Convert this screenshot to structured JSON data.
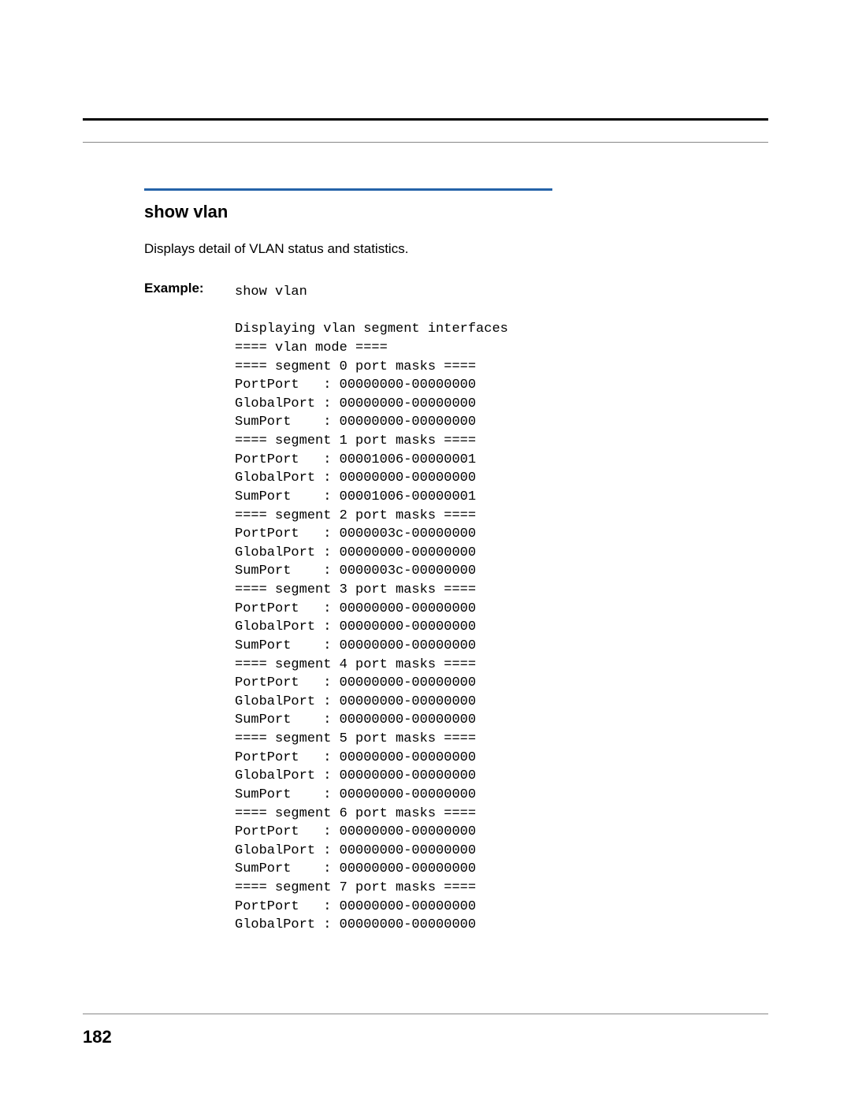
{
  "section": {
    "title": "show vlan",
    "description": "Displays detail of VLAN status and statistics.",
    "example_label": "Example:"
  },
  "code": {
    "cmd": "show vlan",
    "blank1": "",
    "l1": "Displaying vlan segment interfaces",
    "l2": "==== vlan mode ====",
    "l3": "==== segment 0 port masks ====",
    "l4": "PortPort   : 00000000-00000000",
    "l5": "GlobalPort : 00000000-00000000",
    "l6": "SumPort    : 00000000-00000000",
    "l7": "==== segment 1 port masks ====",
    "l8": "PortPort   : 00001006-00000001",
    "l9": "GlobalPort : 00000000-00000000",
    "l10": "SumPort    : 00001006-00000001",
    "l11": "==== segment 2 port masks ====",
    "l12": "PortPort   : 0000003c-00000000",
    "l13": "GlobalPort : 00000000-00000000",
    "l14": "SumPort    : 0000003c-00000000",
    "l15": "==== segment 3 port masks ====",
    "l16": "PortPort   : 00000000-00000000",
    "l17": "GlobalPort : 00000000-00000000",
    "l18": "SumPort    : 00000000-00000000",
    "l19": "==== segment 4 port masks ====",
    "l20": "PortPort   : 00000000-00000000",
    "l21": "GlobalPort : 00000000-00000000",
    "l22": "SumPort    : 00000000-00000000",
    "l23": "==== segment 5 port masks ====",
    "l24": "PortPort   : 00000000-00000000",
    "l25": "GlobalPort : 00000000-00000000",
    "l26": "SumPort    : 00000000-00000000",
    "l27": "==== segment 6 port masks ====",
    "l28": "PortPort   : 00000000-00000000",
    "l29": "GlobalPort : 00000000-00000000",
    "l30": "SumPort    : 00000000-00000000",
    "l31": "==== segment 7 port masks ====",
    "l32": "PortPort   : 00000000-00000000",
    "l33": "GlobalPort : 00000000-00000000"
  },
  "page_number": "182"
}
